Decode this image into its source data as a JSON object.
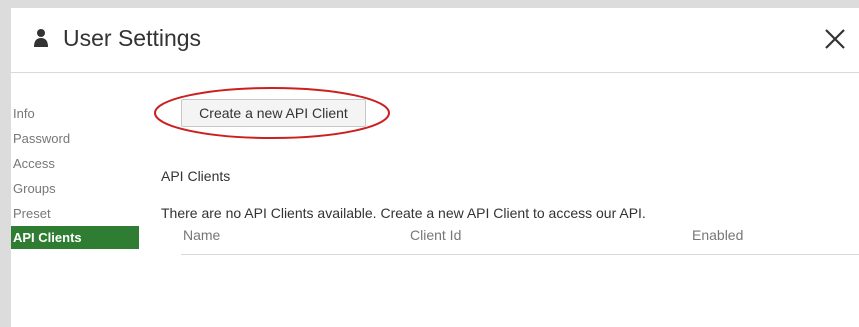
{
  "header": {
    "title": "User Settings",
    "user_icon": "user-icon",
    "close_icon": "close-icon"
  },
  "sidebar": {
    "items": [
      {
        "label": "Info"
      },
      {
        "label": "Password"
      },
      {
        "label": "Access"
      },
      {
        "label": "Groups"
      },
      {
        "label": "Preset"
      },
      {
        "label": "API Clients",
        "active": true
      }
    ],
    "active_color": "#2e7d32"
  },
  "main": {
    "create_button_label": "Create a new API Client",
    "section_title": "API Clients",
    "empty_message": "There are no API Clients available. Create a new API Client to access our API.",
    "table": {
      "columns": [
        "Name",
        "Client Id",
        "Enabled"
      ]
    },
    "highlight_color": "#cc1f1f"
  }
}
